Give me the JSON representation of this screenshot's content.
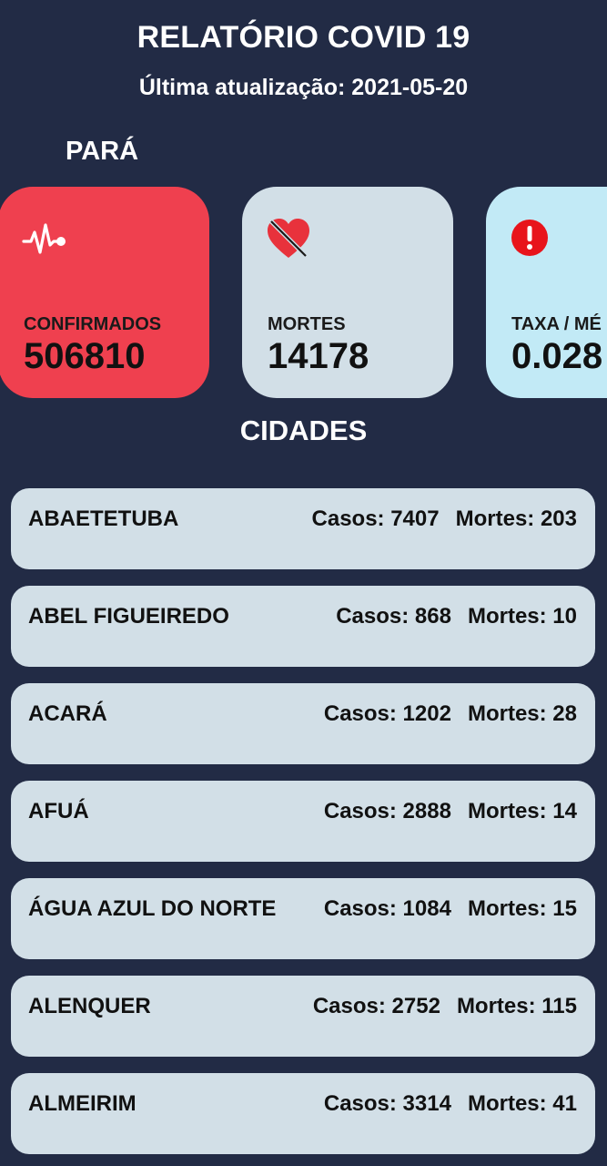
{
  "header": {
    "title": "RELATÓRIO COVID 19",
    "updated": "Última atualização: 2021-05-20"
  },
  "state": {
    "name": "PARÁ"
  },
  "cards": {
    "confirmed": {
      "label": "CONFIRMADOS",
      "value": "506810",
      "icon": "heartbeat-pulse-icon",
      "color": "#ef404f"
    },
    "deaths": {
      "label": "MORTES",
      "value": "14178",
      "icon": "broken-heart-icon",
      "color": "#d2dfe7"
    },
    "rate": {
      "label": "TAXA / MÉ",
      "value": "0.028",
      "icon": "alert-circle-icon",
      "color": "#c2eaf6"
    }
  },
  "cities_section": {
    "title": "CIDADES"
  },
  "cities": [
    {
      "name": "ABAETETUBA",
      "cases": "Casos: 7407",
      "deaths": "Mortes: 203"
    },
    {
      "name": "ABEL FIGUEIREDO",
      "cases": "Casos: 868",
      "deaths": "Mortes: 10"
    },
    {
      "name": "ACARÁ",
      "cases": "Casos: 1202",
      "deaths": "Mortes: 28"
    },
    {
      "name": "AFUÁ",
      "cases": "Casos: 2888",
      "deaths": "Mortes: 14"
    },
    {
      "name": "ÁGUA AZUL DO NORTE",
      "cases": "Casos: 1084",
      "deaths": "Mortes: 15"
    },
    {
      "name": "ALENQUER",
      "cases": "Casos: 2752",
      "deaths": "Mortes: 115"
    },
    {
      "name": "ALMEIRIM",
      "cases": "Casos: 3314",
      "deaths": "Mortes: 41"
    }
  ],
  "theme": {
    "background": "#222b45",
    "row_background": "#d2dfe7"
  }
}
